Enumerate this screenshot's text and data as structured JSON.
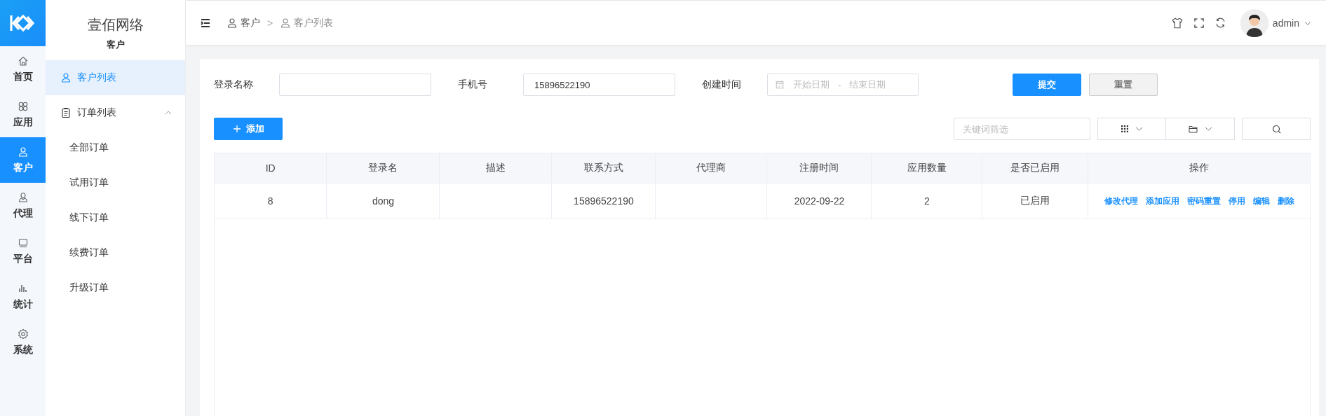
{
  "rail": {
    "items": [
      {
        "label": "首页",
        "selected": false
      },
      {
        "label": "应用",
        "selected": false
      },
      {
        "label": "客户",
        "selected": true
      },
      {
        "label": "代理",
        "selected": false
      },
      {
        "label": "平台",
        "selected": false
      },
      {
        "label": "统计",
        "selected": false
      },
      {
        "label": "系统",
        "selected": false
      }
    ]
  },
  "sidebar": {
    "title": "壹佰网络",
    "subtitle": "客户",
    "items": [
      {
        "label": "客户列表",
        "selected": true
      },
      {
        "label": "订单列表",
        "selected": false,
        "expanded": true,
        "children": [
          {
            "label": "全部订单",
            "selected": false
          },
          {
            "label": "试用订单",
            "selected": false
          },
          {
            "label": "线下订单",
            "selected": false
          },
          {
            "label": "续费订单",
            "selected": false
          },
          {
            "label": "升级订单",
            "selected": false
          }
        ]
      }
    ]
  },
  "header": {
    "breadcrumb": [
      "客户",
      "客户列表"
    ],
    "separator": ">",
    "user": "admin"
  },
  "filters": {
    "fields": [
      {
        "label": "登录名称"
      },
      {
        "label": "手机号",
        "value": "15896522190"
      }
    ],
    "date_range": {
      "label": "创建时间",
      "start_placeholder": "开始日期",
      "separator": "-",
      "end_placeholder": "结束日期"
    },
    "submit": "提交",
    "reset": "重置"
  },
  "toolbar": {
    "add_button": "添加",
    "keyword": {
      "placeholder": "关键词筛选"
    }
  },
  "table": {
    "columns": [
      "ID",
      "登录名",
      "描述",
      "联系方式",
      "代理商",
      "注册时间",
      "应用数量",
      "是否已启用",
      "操作"
    ],
    "rows": [
      {
        "cells": [
          "8",
          "dong",
          "",
          "15896522190",
          "",
          "2022-09-22",
          "2",
          "已启用"
        ],
        "actions": [
          "修改代理",
          "添加应用",
          "密码重置",
          "停用",
          "编辑",
          "删除"
        ]
      }
    ]
  }
}
